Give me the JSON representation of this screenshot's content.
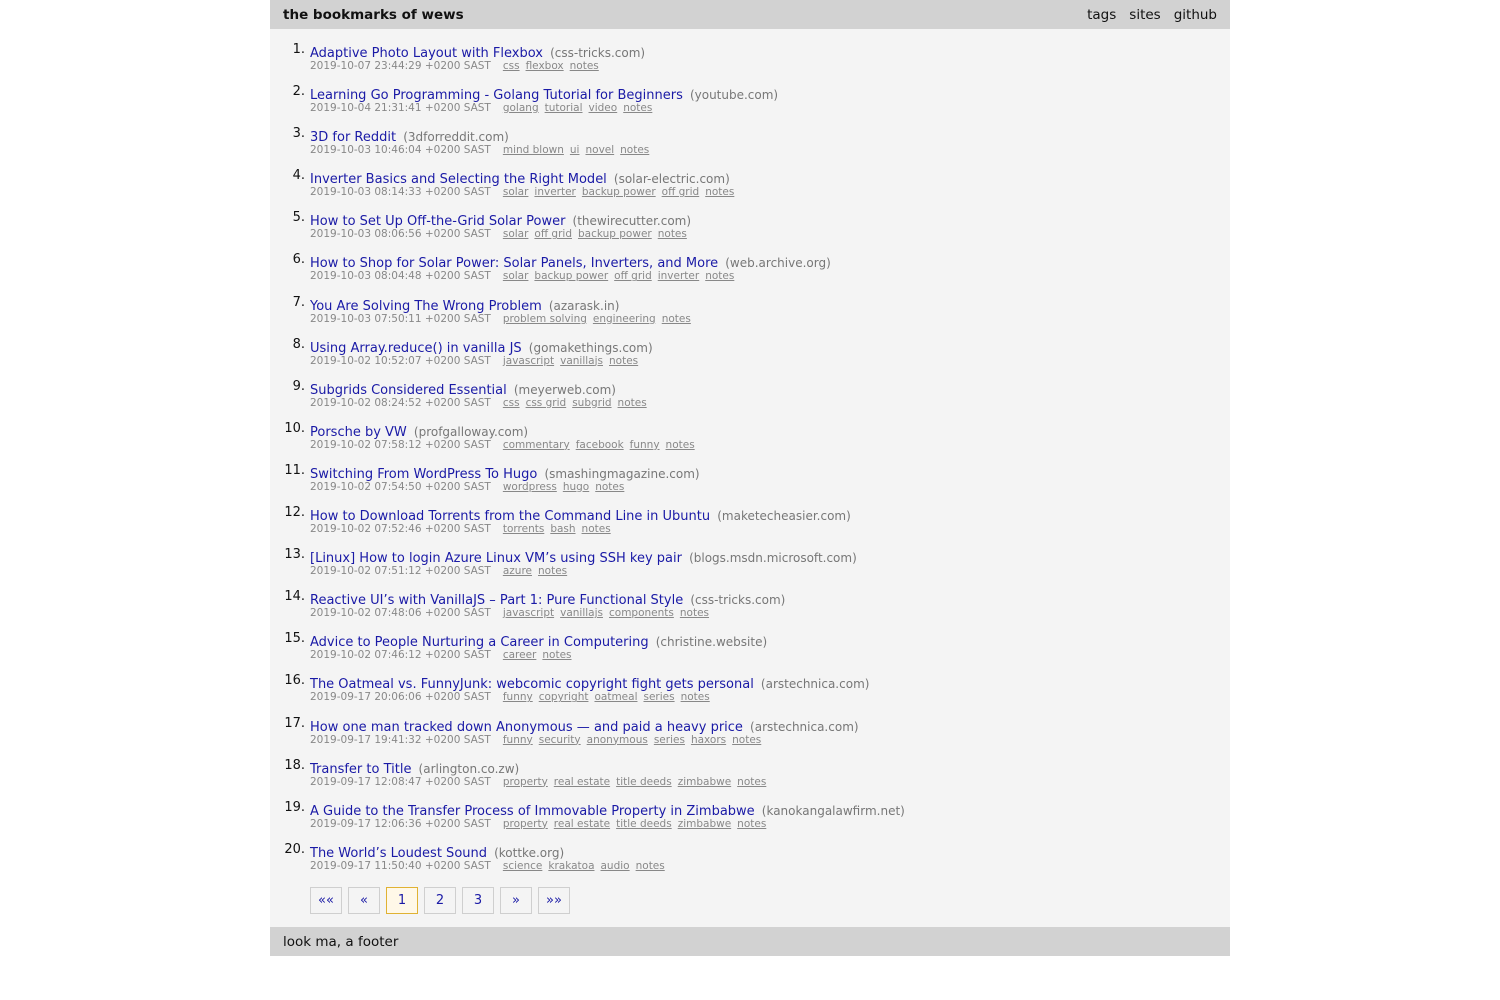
{
  "header": {
    "title": "the bookmarks of wews",
    "nav": [
      {
        "label": "tags"
      },
      {
        "label": "sites"
      },
      {
        "label": "github"
      }
    ]
  },
  "bookmarks": [
    {
      "num": "1.",
      "title": "Adaptive Photo Layout with Flexbox",
      "site": "(css-tricks.com)",
      "date": "2019-10-07 23:44:29 +0200 SAST",
      "tags": [
        "css",
        "flexbox",
        "notes"
      ]
    },
    {
      "num": "2.",
      "title": "Learning Go Programming - Golang Tutorial for Beginners",
      "site": "(youtube.com)",
      "date": "2019-10-04 21:31:41 +0200 SAST",
      "tags": [
        "golang",
        "tutorial",
        "video",
        "notes"
      ]
    },
    {
      "num": "3.",
      "title": "3D for Reddit",
      "site": "(3dforreddit.com)",
      "date": "2019-10-03 10:46:04 +0200 SAST",
      "tags": [
        "mind blown",
        "ui",
        "novel",
        "notes"
      ]
    },
    {
      "num": "4.",
      "title": "Inverter Basics and Selecting the Right Model",
      "site": "(solar-electric.com)",
      "date": "2019-10-03 08:14:33 +0200 SAST",
      "tags": [
        "solar",
        "inverter",
        "backup power",
        "off grid",
        "notes"
      ]
    },
    {
      "num": "5.",
      "title": "How to Set Up Off-the-Grid Solar Power",
      "site": "(thewirecutter.com)",
      "date": "2019-10-03 08:06:56 +0200 SAST",
      "tags": [
        "solar",
        "off grid",
        "backup power",
        "notes"
      ]
    },
    {
      "num": "6.",
      "title": "How to Shop for Solar Power: Solar Panels, Inverters, and More",
      "site": "(web.archive.org)",
      "date": "2019-10-03 08:04:48 +0200 SAST",
      "tags": [
        "solar",
        "backup power",
        "off grid",
        "inverter",
        "notes"
      ]
    },
    {
      "num": "7.",
      "title": "You Are Solving The Wrong Problem",
      "site": "(azarask.in)",
      "date": "2019-10-03 07:50:11 +0200 SAST",
      "tags": [
        "problem solving",
        "engineering",
        "notes"
      ]
    },
    {
      "num": "8.",
      "title": "Using Array.reduce() in vanilla JS",
      "site": "(gomakethings.com)",
      "date": "2019-10-02 10:52:07 +0200 SAST",
      "tags": [
        "javascript",
        "vanillajs",
        "notes"
      ]
    },
    {
      "num": "9.",
      "title": "Subgrids Considered Essential",
      "site": "(meyerweb.com)",
      "date": "2019-10-02 08:24:52 +0200 SAST",
      "tags": [
        "css",
        "css grid",
        "subgrid",
        "notes"
      ]
    },
    {
      "num": "10.",
      "title": "Porsche by VW",
      "site": "(profgalloway.com)",
      "date": "2019-10-02 07:58:12 +0200 SAST",
      "tags": [
        "commentary",
        "facebook",
        "funny",
        "notes"
      ]
    },
    {
      "num": "11.",
      "title": "Switching From WordPress To Hugo",
      "site": "(smashingmagazine.com)",
      "date": "2019-10-02 07:54:50 +0200 SAST",
      "tags": [
        "wordpress",
        "hugo",
        "notes"
      ]
    },
    {
      "num": "12.",
      "title": "How to Download Torrents from the Command Line in Ubuntu",
      "site": "(maketecheasier.com)",
      "date": "2019-10-02 07:52:46 +0200 SAST",
      "tags": [
        "torrents",
        "bash",
        "notes"
      ]
    },
    {
      "num": "13.",
      "title": "[Linux] How to login Azure Linux VM’s using SSH key pair",
      "site": "(blogs.msdn.microsoft.com)",
      "date": "2019-10-02 07:51:12 +0200 SAST",
      "tags": [
        "azure",
        "notes"
      ]
    },
    {
      "num": "14.",
      "title": "Reactive UI’s with VanillaJS – Part 1: Pure Functional Style",
      "site": "(css-tricks.com)",
      "date": "2019-10-02 07:48:06 +0200 SAST",
      "tags": [
        "javascript",
        "vanillajs",
        "components",
        "notes"
      ]
    },
    {
      "num": "15.",
      "title": "Advice to People Nurturing a Career in Computering",
      "site": "(christine.website)",
      "date": "2019-10-02 07:46:12 +0200 SAST",
      "tags": [
        "career",
        "notes"
      ]
    },
    {
      "num": "16.",
      "title": "The Oatmeal vs. FunnyJunk: webcomic copyright fight gets personal",
      "site": "(arstechnica.com)",
      "date": "2019-09-17 20:06:06 +0200 SAST",
      "tags": [
        "funny",
        "copyright",
        "oatmeal",
        "series",
        "notes"
      ]
    },
    {
      "num": "17.",
      "title": "How one man tracked down Anonymous — and paid a heavy price",
      "site": "(arstechnica.com)",
      "date": "2019-09-17 19:41:32 +0200 SAST",
      "tags": [
        "funny",
        "security",
        "anonymous",
        "series",
        "haxors",
        "notes"
      ]
    },
    {
      "num": "18.",
      "title": "Transfer to Title",
      "site": "(arlington.co.zw)",
      "date": "2019-09-17 12:08:47 +0200 SAST",
      "tags": [
        "property",
        "real estate",
        "title deeds",
        "zimbabwe",
        "notes"
      ]
    },
    {
      "num": "19.",
      "title": "A Guide to the Transfer Process of Immovable Property in Zimbabwe",
      "site": "(kanokangalawfirm.net)",
      "date": "2019-09-17 12:06:36 +0200 SAST",
      "tags": [
        "property",
        "real estate",
        "title deeds",
        "zimbabwe",
        "notes"
      ]
    },
    {
      "num": "20.",
      "title": "The World’s Loudest Sound",
      "site": "(kottke.org)",
      "date": "2019-09-17 11:50:40 +0200 SAST",
      "tags": [
        "science",
        "krakatoa",
        "audio",
        "notes"
      ]
    }
  ],
  "pagination": [
    {
      "label": "««",
      "active": false
    },
    {
      "label": "«",
      "active": false
    },
    {
      "label": "1",
      "active": true
    },
    {
      "label": "2",
      "active": false
    },
    {
      "label": "3",
      "active": false
    },
    {
      "label": "»",
      "active": false
    },
    {
      "label": "»»",
      "active": false
    }
  ],
  "footer": {
    "text": "look ma, a footer"
  }
}
